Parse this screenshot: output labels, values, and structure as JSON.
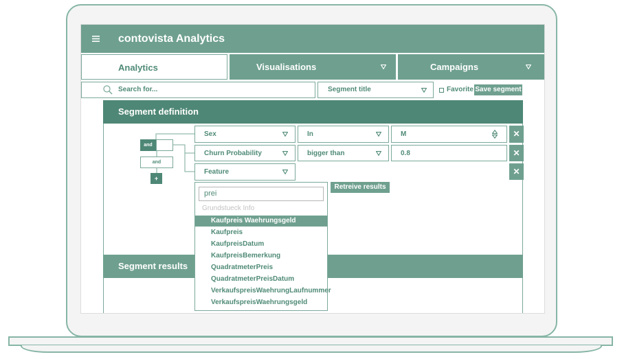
{
  "app": {
    "title": "contovista Analytics"
  },
  "tabs": [
    {
      "label": "Analytics"
    },
    {
      "label": "Visualisations"
    },
    {
      "label": "Campaigns"
    }
  ],
  "search": {
    "placeholder": "Search for...",
    "segment_title": "Segment title",
    "favorite_label": "Favorite",
    "save_label": "Save segment"
  },
  "definition": {
    "title": "Segment definition",
    "tree": {
      "and_top": "and",
      "and_bottom": "and",
      "add": "+"
    },
    "rows": [
      {
        "field": "Sex",
        "operator": "In",
        "value": "M"
      },
      {
        "field": "Churn Probability",
        "operator": "bigger than",
        "value": "0.8"
      },
      {
        "field": "Feature"
      }
    ],
    "retrieve_label": "Retreive results"
  },
  "dropdown": {
    "query": "prei",
    "group": "Grundstueck Info",
    "selected_index": 0,
    "items": [
      "Kaufpreis Waehrungsgeld",
      "Kaufpreis",
      "KaufpreisDatum",
      "KaufpreisBemerkung",
      "QuadratmeterPreis",
      "QuadratmeterPreisDatum",
      "VerkaufspreisWaehrungLaufnummer",
      "VerkaufspreisWaehrungsgeld"
    ]
  },
  "results": {
    "title": "Segment results"
  },
  "icons": {
    "menu": "menu-icon",
    "search": "search-icon",
    "dropdown": "chevron-down-icon",
    "spinner": "up-down-icon",
    "remove": "close-icon",
    "favorite": "checkbox-icon"
  },
  "colors": {
    "primary": "#6fa08f",
    "primary_dark": "#4e8775",
    "text": "#4f8a77",
    "border": "#7aa89a"
  }
}
